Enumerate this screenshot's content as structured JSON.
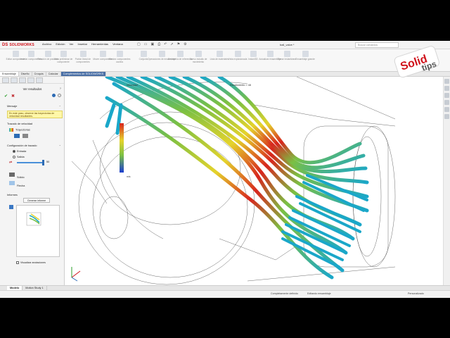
{
  "app": {
    "brand_ds": "DS",
    "brand_name": "SOLIDWORKS",
    "menus": [
      "Archivo",
      "Edición",
      "Ver",
      "Insertar",
      "Herramientas",
      "Ventana"
    ],
    "doc_title": "ball_valve *",
    "search_placeholder": "Buscar comandos"
  },
  "ribbon": {
    "buttons": [
      "Editar componente",
      "Insertar componentes",
      "Relación de posición",
      "Vista preliminar de componente",
      "Patrón lineal de componentes",
      "Mover componente",
      "Mostrar componentes ocultos",
      "Conjunto",
      "Operaciones de ensamblaje",
      "Geometría de referencia",
      "Nuevo estudio de movimiento",
      "Lista de materiales",
      "Vista explosionada",
      "Instant3D",
      "Actualizar ensamblaje",
      "Tomar instantánea",
      "Ensamblaje grande"
    ]
  },
  "command_tabs": [
    "Ensamblaje",
    "Diseño",
    "Croquis",
    "Calcular",
    "Complementos de SOLIDWORKS"
  ],
  "panel": {
    "title": "Ver resultados",
    "message_header": "Mensaje",
    "message_text": "En este paso, observe las trayectorias de velocidad resultantes.",
    "trajectory_header": "Trazado de velocidad",
    "trajectory_item": "Trayectorias",
    "config_header": "Configuración de trazado",
    "config_opt1": "Entrada",
    "config_opt2": "Salida",
    "slider_value": "50",
    "draw_opt1": "Sólido",
    "draw_opt2": "Flecha",
    "report_header": "Informes",
    "report_button": "Generar informe",
    "show_annotations": "Visualizar anotaciones"
  },
  "viewport": {
    "legend_title": "Velocidad",
    "legend_unit": "m/s",
    "view_label": "Rendimiento = 48"
  },
  "bottom_tabs": [
    "Modelo",
    "Motion Study 1"
  ],
  "status": {
    "left": "",
    "middle_1": "Completamente definido",
    "middle_2": "Editando ensamblaje",
    "right": "Personalizado"
  },
  "overlay": {
    "solid": "Solid",
    "tips": "tips"
  },
  "colors": {
    "accent": "#d0121b",
    "ok": "#2a9c2a",
    "cancel": "#c0282d",
    "message_bg": "#fff7a8",
    "tube_cold": "#1aa7c9",
    "tube_hot": "#d7261e"
  }
}
